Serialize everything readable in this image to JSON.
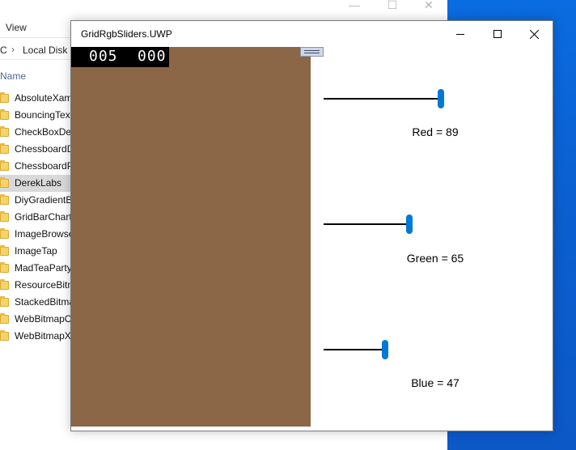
{
  "explorer": {
    "ribbon_tab": "View",
    "breadcrumb_root": "C",
    "breadcrumb_disk": "Local Disk (",
    "column_header": "Name",
    "files": [
      {
        "name": "AbsoluteXam",
        "selected": false
      },
      {
        "name": "BouncingText",
        "selected": false
      },
      {
        "name": "CheckBoxDer",
        "selected": false
      },
      {
        "name": "ChessboardD",
        "selected": false
      },
      {
        "name": "ChessboardP",
        "selected": false
      },
      {
        "name": "DerekLabs",
        "selected": true
      },
      {
        "name": "DiyGradientB",
        "selected": false
      },
      {
        "name": "GridBarChart",
        "selected": false
      },
      {
        "name": "ImageBrowse",
        "selected": false
      },
      {
        "name": "ImageTap",
        "selected": false
      },
      {
        "name": "MadTeaParty",
        "selected": false
      },
      {
        "name": "ResourceBitm",
        "selected": false
      },
      {
        "name": "StackedBitma",
        "selected": false
      },
      {
        "name": "WebBitmapC",
        "selected": false
      },
      {
        "name": "WebBitmapX",
        "selected": false
      }
    ],
    "controls": {
      "minimize": "—",
      "maximize": "☐",
      "close": "✕"
    }
  },
  "app": {
    "title": "GridRgbSliders.UWP",
    "fps_counter": [
      "005",
      "000"
    ],
    "swatch_color": "#8b6647",
    "slider_max": 255,
    "sliders": [
      {
        "channel": "red",
        "value": 89,
        "label": "Red = 89"
      },
      {
        "channel": "green",
        "value": 65,
        "label": "Green = 65"
      },
      {
        "channel": "blue",
        "value": 47,
        "label": "Blue = 47"
      }
    ],
    "accent_color": "#0078d7",
    "desktop_color": "#0b63d6"
  }
}
